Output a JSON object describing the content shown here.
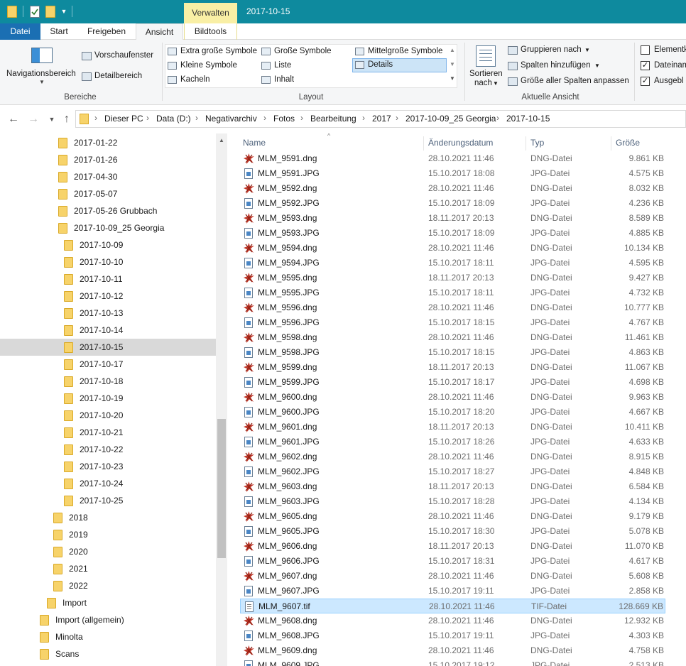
{
  "title_bar": {
    "contextual_tab_label": "Verwalten",
    "window_title": "2017-10-15"
  },
  "tabs": {
    "file": "Datei",
    "start": "Start",
    "share": "Freigeben",
    "view": "Ansicht",
    "picture_tools": "Bildtools"
  },
  "ribbon": {
    "panes": {
      "navigation_pane": "Navigationsbereich",
      "preview_pane": "Vorschaufenster",
      "details_pane": "Detailbereich",
      "group_label": "Bereiche"
    },
    "layout": {
      "items": [
        "Extra große Symbole",
        "Große Symbole",
        "Mittelgroße Symbole",
        "Kleine Symbole",
        "Liste",
        "Details",
        "Kacheln",
        "Inhalt"
      ],
      "selected": "Details",
      "group_label": "Layout"
    },
    "current_view": {
      "sort_by_line1": "Sortieren",
      "sort_by_line2": "nach",
      "group_by": "Gruppieren nach",
      "add_columns": "Spalten hinzufügen",
      "size_columns": "Größe aller Spalten anpassen",
      "group_label": "Aktuelle Ansicht"
    },
    "show_hide": {
      "item_checkboxes": "Elementk",
      "file_extensions": "Dateinam",
      "hidden_items": "Ausgebl"
    }
  },
  "address": {
    "breadcrumbs": [
      "Dieser PC",
      "Data (D:)",
      "Negativarchiv",
      "Fotos",
      "Bearbeitung",
      "2017",
      "2017-10-09_25 Georgia",
      "2017-10-15"
    ]
  },
  "nav_tree": [
    {
      "label": "2017-01-22",
      "level": 0
    },
    {
      "label": "2017-01-26",
      "level": 0
    },
    {
      "label": "2017-04-30",
      "level": 0
    },
    {
      "label": "2017-05-07",
      "level": 0
    },
    {
      "label": "2017-05-26 Grubbach",
      "level": 0
    },
    {
      "label": "2017-10-09_25 Georgia",
      "level": 0
    },
    {
      "label": "2017-10-09",
      "level": 1
    },
    {
      "label": "2017-10-10",
      "level": 1
    },
    {
      "label": "2017-10-11",
      "level": 1
    },
    {
      "label": "2017-10-12",
      "level": 1
    },
    {
      "label": "2017-10-13",
      "level": 1
    },
    {
      "label": "2017-10-14",
      "level": 1
    },
    {
      "label": "2017-10-15",
      "level": 1,
      "selected": true
    },
    {
      "label": "2017-10-17",
      "level": 1
    },
    {
      "label": "2017-10-18",
      "level": 1
    },
    {
      "label": "2017-10-19",
      "level": 1
    },
    {
      "label": "2017-10-20",
      "level": 1
    },
    {
      "label": "2017-10-21",
      "level": 1
    },
    {
      "label": "2017-10-22",
      "level": 1
    },
    {
      "label": "2017-10-23",
      "level": 1
    },
    {
      "label": "2017-10-24",
      "level": 1
    },
    {
      "label": "2017-10-25",
      "level": 1
    },
    {
      "label": "2018",
      "level": -1
    },
    {
      "label": "2019",
      "level": -1
    },
    {
      "label": "2020",
      "level": -1
    },
    {
      "label": "2021",
      "level": -1
    },
    {
      "label": "2022",
      "level": -1
    },
    {
      "label": "Import",
      "level": -2
    },
    {
      "label": "Import (allgemein)",
      "level": -3
    },
    {
      "label": "Minolta",
      "level": -3
    },
    {
      "label": "Scans",
      "level": -3
    }
  ],
  "file_list": {
    "columns": {
      "name": "Name",
      "date": "Änderungsdatum",
      "type": "Typ",
      "size": "Größe"
    },
    "rows": [
      {
        "name": "MLM_9591.dng",
        "date": "28.10.2021 11:46",
        "type": "DNG-Datei",
        "size": "9.861 KB",
        "icon": "dng-icon"
      },
      {
        "name": "MLM_9591.JPG",
        "date": "15.10.2017 18:08",
        "type": "JPG-Datei",
        "size": "4.575 KB",
        "icon": "jpg-icon"
      },
      {
        "name": "MLM_9592.dng",
        "date": "28.10.2021 11:46",
        "type": "DNG-Datei",
        "size": "8.032 KB",
        "icon": "dng-icon"
      },
      {
        "name": "MLM_9592.JPG",
        "date": "15.10.2017 18:09",
        "type": "JPG-Datei",
        "size": "4.236 KB",
        "icon": "jpg-icon"
      },
      {
        "name": "MLM_9593.dng",
        "date": "18.11.2017 20:13",
        "type": "DNG-Datei",
        "size": "8.589 KB",
        "icon": "dng-icon"
      },
      {
        "name": "MLM_9593.JPG",
        "date": "15.10.2017 18:09",
        "type": "JPG-Datei",
        "size": "4.885 KB",
        "icon": "jpg-icon"
      },
      {
        "name": "MLM_9594.dng",
        "date": "28.10.2021 11:46",
        "type": "DNG-Datei",
        "size": "10.134 KB",
        "icon": "dng-icon"
      },
      {
        "name": "MLM_9594.JPG",
        "date": "15.10.2017 18:11",
        "type": "JPG-Datei",
        "size": "4.595 KB",
        "icon": "jpg-icon"
      },
      {
        "name": "MLM_9595.dng",
        "date": "18.11.2017 20:13",
        "type": "DNG-Datei",
        "size": "9.427 KB",
        "icon": "dng-icon"
      },
      {
        "name": "MLM_9595.JPG",
        "date": "15.10.2017 18:11",
        "type": "JPG-Datei",
        "size": "4.732 KB",
        "icon": "jpg-icon"
      },
      {
        "name": "MLM_9596.dng",
        "date": "28.10.2021 11:46",
        "type": "DNG-Datei",
        "size": "10.777 KB",
        "icon": "dng-icon"
      },
      {
        "name": "MLM_9596.JPG",
        "date": "15.10.2017 18:15",
        "type": "JPG-Datei",
        "size": "4.767 KB",
        "icon": "jpg-icon"
      },
      {
        "name": "MLM_9598.dng",
        "date": "28.10.2021 11:46",
        "type": "DNG-Datei",
        "size": "11.461 KB",
        "icon": "dng-icon"
      },
      {
        "name": "MLM_9598.JPG",
        "date": "15.10.2017 18:15",
        "type": "JPG-Datei",
        "size": "4.863 KB",
        "icon": "jpg-icon"
      },
      {
        "name": "MLM_9599.dng",
        "date": "18.11.2017 20:13",
        "type": "DNG-Datei",
        "size": "11.067 KB",
        "icon": "dng-icon"
      },
      {
        "name": "MLM_9599.JPG",
        "date": "15.10.2017 18:17",
        "type": "JPG-Datei",
        "size": "4.698 KB",
        "icon": "jpg-icon"
      },
      {
        "name": "MLM_9600.dng",
        "date": "28.10.2021 11:46",
        "type": "DNG-Datei",
        "size": "9.963 KB",
        "icon": "dng-icon"
      },
      {
        "name": "MLM_9600.JPG",
        "date": "15.10.2017 18:20",
        "type": "JPG-Datei",
        "size": "4.667 KB",
        "icon": "jpg-icon"
      },
      {
        "name": "MLM_9601.dng",
        "date": "18.11.2017 20:13",
        "type": "DNG-Datei",
        "size": "10.411 KB",
        "icon": "dng-icon"
      },
      {
        "name": "MLM_9601.JPG",
        "date": "15.10.2017 18:26",
        "type": "JPG-Datei",
        "size": "4.633 KB",
        "icon": "jpg-icon"
      },
      {
        "name": "MLM_9602.dng",
        "date": "28.10.2021 11:46",
        "type": "DNG-Datei",
        "size": "8.915 KB",
        "icon": "dng-icon"
      },
      {
        "name": "MLM_9602.JPG",
        "date": "15.10.2017 18:27",
        "type": "JPG-Datei",
        "size": "4.848 KB",
        "icon": "jpg-icon"
      },
      {
        "name": "MLM_9603.dng",
        "date": "18.11.2017 20:13",
        "type": "DNG-Datei",
        "size": "6.584 KB",
        "icon": "dng-icon"
      },
      {
        "name": "MLM_9603.JPG",
        "date": "15.10.2017 18:28",
        "type": "JPG-Datei",
        "size": "4.134 KB",
        "icon": "jpg-icon"
      },
      {
        "name": "MLM_9605.dng",
        "date": "28.10.2021 11:46",
        "type": "DNG-Datei",
        "size": "9.179 KB",
        "icon": "dng-icon"
      },
      {
        "name": "MLM_9605.JPG",
        "date": "15.10.2017 18:30",
        "type": "JPG-Datei",
        "size": "5.078 KB",
        "icon": "jpg-icon"
      },
      {
        "name": "MLM_9606.dng",
        "date": "18.11.2017 20:13",
        "type": "DNG-Datei",
        "size": "11.070 KB",
        "icon": "dng-icon"
      },
      {
        "name": "MLM_9606.JPG",
        "date": "15.10.2017 18:31",
        "type": "JPG-Datei",
        "size": "4.617 KB",
        "icon": "jpg-icon"
      },
      {
        "name": "MLM_9607.dng",
        "date": "28.10.2021 11:46",
        "type": "DNG-Datei",
        "size": "5.608 KB",
        "icon": "dng-icon"
      },
      {
        "name": "MLM_9607.JPG",
        "date": "15.10.2017 19:11",
        "type": "JPG-Datei",
        "size": "2.858 KB",
        "icon": "jpg-icon"
      },
      {
        "name": "MLM_9607.tif",
        "date": "28.10.2021 11:46",
        "type": "TIF-Datei",
        "size": "128.669 KB",
        "icon": "tif-icon",
        "selected": true
      },
      {
        "name": "MLM_9608.dng",
        "date": "28.10.2021 11:46",
        "type": "DNG-Datei",
        "size": "12.932 KB",
        "icon": "dng-icon"
      },
      {
        "name": "MLM_9608.JPG",
        "date": "15.10.2017 19:11",
        "type": "JPG-Datei",
        "size": "4.303 KB",
        "icon": "jpg-icon"
      },
      {
        "name": "MLM_9609.dng",
        "date": "28.10.2021 11:46",
        "type": "DNG-Datei",
        "size": "4.758 KB",
        "icon": "dng-icon"
      },
      {
        "name": "MLM_9609.JPG",
        "date": "15.10.2017 19:12",
        "type": "JPG-Datei",
        "size": "2.513 KB",
        "icon": "jpg-icon"
      }
    ]
  },
  "colors": {
    "title_bar": "#0e8a9e",
    "contextual_tab": "#f9efa5",
    "file_tab": "#1b6fb3",
    "selection": "#cce8ff",
    "folder": "#f7d36a",
    "dng_icon": "#c0392b"
  }
}
